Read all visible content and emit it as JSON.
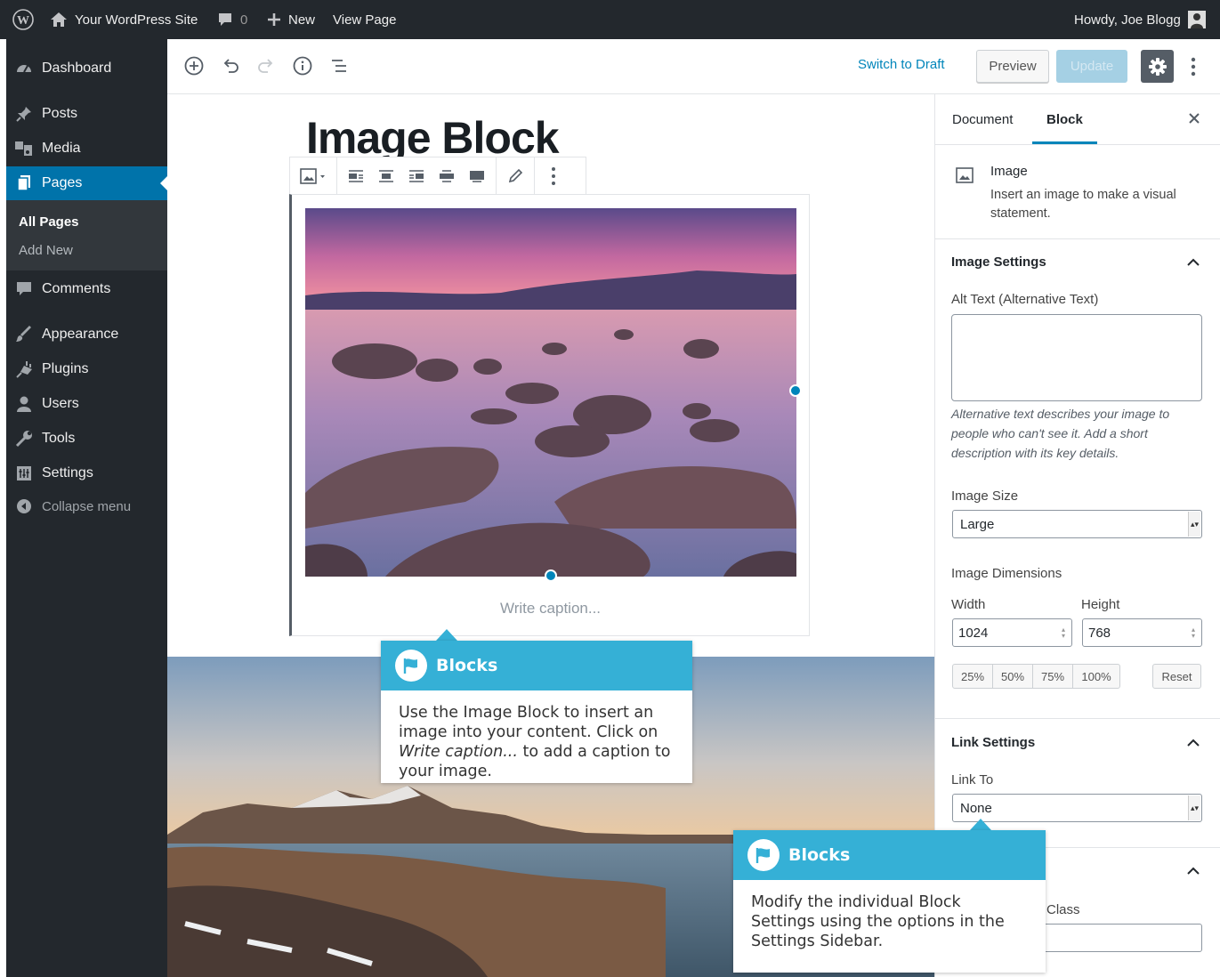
{
  "admin_bar": {
    "site_name": "Your WordPress Site",
    "comments_count": "0",
    "new_label": "New",
    "view_page_label": "View Page",
    "greeting": "Howdy, Joe Blogg"
  },
  "admin_menu": {
    "dashboard": "Dashboard",
    "posts": "Posts",
    "media": "Media",
    "pages": "Pages",
    "pages_submenu": [
      "All Pages",
      "Add New"
    ],
    "comments": "Comments",
    "appearance": "Appearance",
    "plugins": "Plugins",
    "users": "Users",
    "tools": "Tools",
    "settings": "Settings",
    "collapse": "Collapse menu"
  },
  "editor_header": {
    "switch_to_draft": "Switch to Draft",
    "preview": "Preview",
    "update": "Update"
  },
  "canvas": {
    "post_title": "Image Block",
    "caption_placeholder": "Write caption..."
  },
  "sidebar": {
    "tabs": [
      "Document",
      "Block"
    ],
    "active_tab": "Block",
    "block_name": "Image",
    "block_description": "Insert an image to make a visual statement.",
    "image_settings": {
      "title": "Image Settings",
      "alt_label": "Alt Text (Alternative Text)",
      "alt_value": "",
      "alt_help": "Alternative text describes your image to people who can't see it. Add a short description with its key details.",
      "size_label": "Image Size",
      "size_value": "Large",
      "dimensions_label": "Image Dimensions",
      "width_label": "Width",
      "width_value": "1024",
      "height_label": "Height",
      "height_value": "768",
      "percent_buttons": [
        "25%",
        "50%",
        "75%",
        "100%"
      ],
      "reset": "Reset"
    },
    "link_settings": {
      "title": "Link Settings",
      "link_to_label": "Link To",
      "link_to_value": "None"
    },
    "advanced": {
      "class_label_partial": "Class"
    }
  },
  "callouts": [
    {
      "title": "Blocks",
      "body_before": "Use the Image Block to insert an image into your content. Click on ",
      "body_em": "Write caption...",
      "body_after": " to add a caption to your image."
    },
    {
      "title": "Blocks",
      "body": "Modify the individual Block Settings using the options in the Settings Sidebar."
    }
  ],
  "colors": {
    "admin_dark": "#23282d",
    "wp_blue": "#0073aa",
    "accent_blue": "#0085ba",
    "callout_blue": "#35b0d6"
  }
}
